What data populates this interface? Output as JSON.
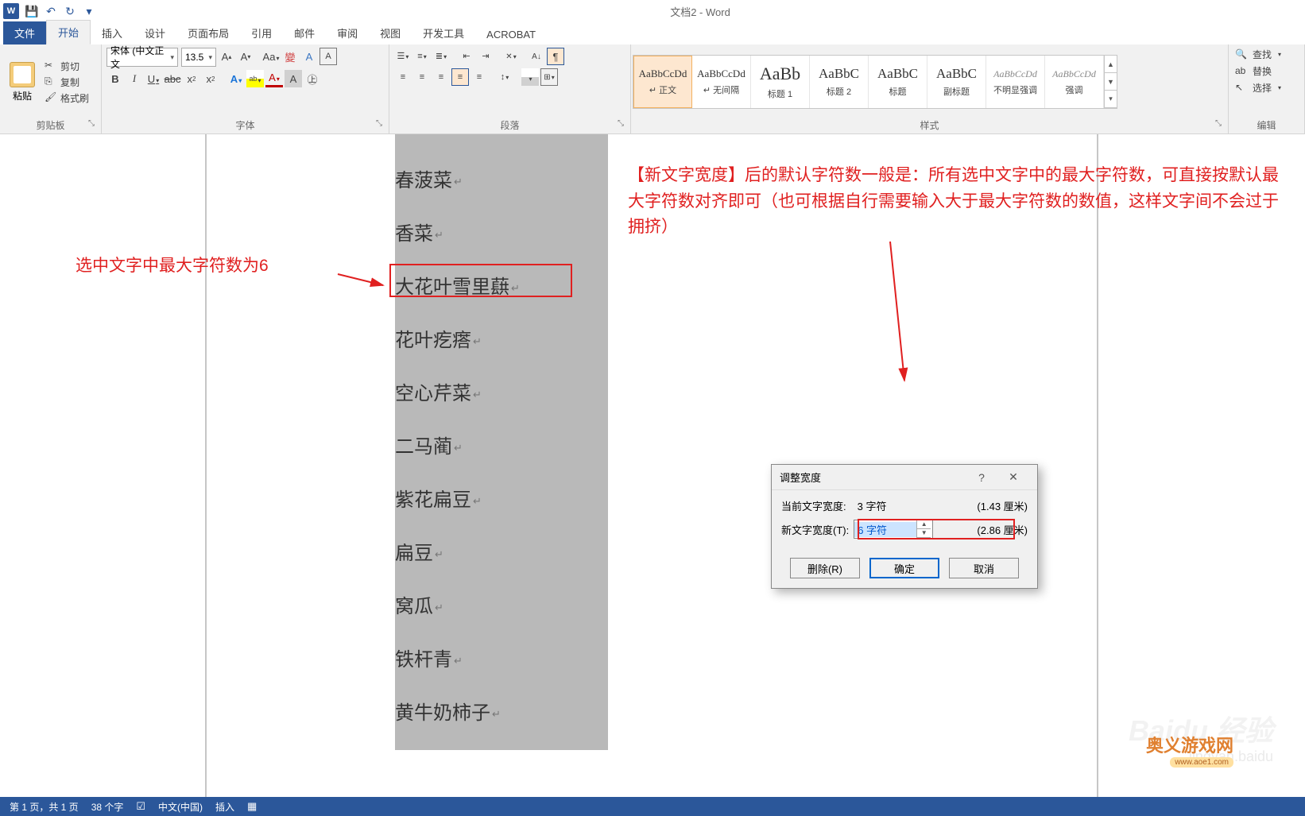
{
  "title_bar": {
    "doc_title": "文档2 - Word"
  },
  "tabs": {
    "file": "文件",
    "home": "开始",
    "insert": "插入",
    "design": "设计",
    "layout": "页面布局",
    "references": "引用",
    "mailings": "邮件",
    "review": "审阅",
    "view": "视图",
    "developer": "开发工具",
    "acrobat": "ACROBAT"
  },
  "groups": {
    "clipboard": {
      "label": "剪贴板",
      "paste": "粘贴",
      "cut": "剪切",
      "copy": "复制",
      "format_painter": "格式刷"
    },
    "font": {
      "label": "字体",
      "name": "宋体 (中文正文",
      "size": "13.5"
    },
    "paragraph": {
      "label": "段落"
    },
    "styles": {
      "label": "样式",
      "items": [
        {
          "preview": "AaBbCcDd",
          "name": "↵ 正文",
          "size": 13
        },
        {
          "preview": "AaBbCcDd",
          "name": "↵ 无间隔",
          "size": 13
        },
        {
          "preview": "AaBb",
          "name": "标题 1",
          "size": 22
        },
        {
          "preview": "AaBbC",
          "name": "标题 2",
          "size": 17
        },
        {
          "preview": "AaBbC",
          "name": "标题",
          "size": 17
        },
        {
          "preview": "AaBbC",
          "name": "副标题",
          "size": 17
        },
        {
          "preview": "AaBbCcDd",
          "name": "不明显强调",
          "size": 12
        },
        {
          "preview": "AaBbCcDd",
          "name": "强调",
          "size": 12
        }
      ]
    },
    "editing": {
      "label": "编辑",
      "find": "查找",
      "replace": "替换",
      "select": "选择"
    }
  },
  "document": {
    "lines": [
      "春菠菜",
      "香菜",
      "大花叶雪里蕻",
      "花叶疙瘩",
      "空心芹菜",
      "二马蔺",
      "紫花扁豆",
      "扁豆",
      "窝瓜",
      "铁杆青",
      "黄牛奶柿子"
    ]
  },
  "annotations": {
    "left": "选中文字中最大字符数为6",
    "right": "【新文字宽度】后的默认字符数一般是：所有选中文字中的最大字符数，可直接按默认最大字符数对齐即可（也可根据自行需要输入大于最大字符数的数值，这样文字间不会过于拥挤）"
  },
  "dialog": {
    "title": "调整宽度",
    "row1_label": "当前文字宽度:",
    "row1_val": "3 字符",
    "row1_cm": "(1.43 厘米)",
    "row2_label": "新文字宽度(T):",
    "row2_val": "6 字符",
    "row2_cm": "(2.86 厘米)",
    "btn_remove": "删除(R)",
    "btn_ok": "确定",
    "btn_cancel": "取消"
  },
  "status": {
    "page": "第 1 页，共 1 页",
    "words": "38 个字",
    "lang": "中文(中国)",
    "mode": "插入"
  },
  "watermark": {
    "main": "Baidu 经验",
    "sub": "jingyan.baidu"
  },
  "site_logo": {
    "name": "奥义游戏网",
    "url": "www.aoe1.com"
  }
}
